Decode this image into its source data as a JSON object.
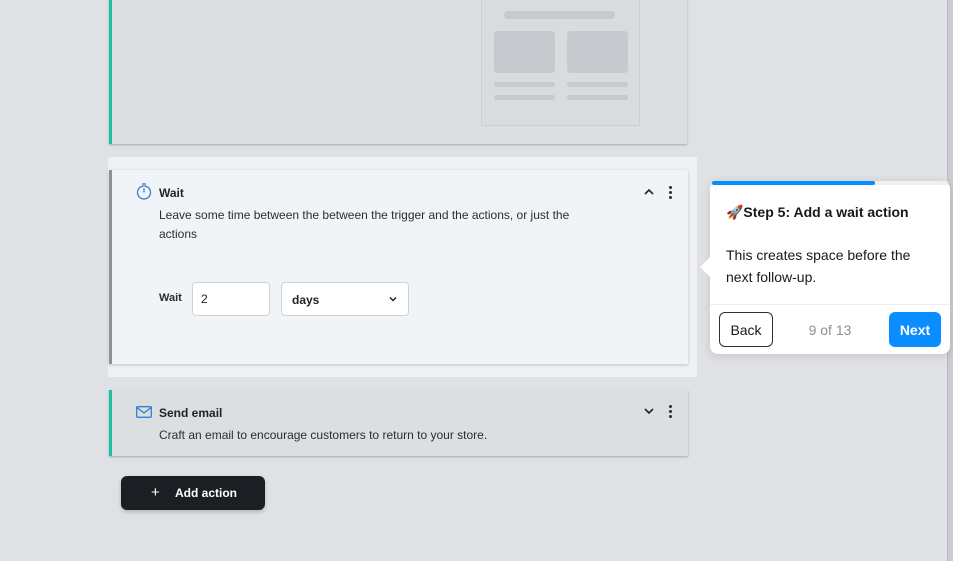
{
  "workflow": {
    "wait_card": {
      "title": "Wait",
      "description": "Leave some time between the between the trigger and the actions, or just the actions",
      "field_label": "Wait",
      "amount_value": "2",
      "unit_selected": "days",
      "icon": "clock-icon",
      "accent_color": "#8a9099"
    },
    "email_card": {
      "title": "Send email",
      "description": "Craft an email to encourage customers to return to your store.",
      "icon": "mail-icon",
      "accent_color": "#1cbfa2"
    },
    "add_action": {
      "icon": "+",
      "label": "Add action"
    }
  },
  "tour": {
    "title": "🚀Step 5: Add a wait action",
    "body": "This creates space before the next follow-up.",
    "back_label": "Back",
    "next_label": "Next",
    "step_text": "9 of 13",
    "progress": 0.69,
    "accent_color": "#0a8dff"
  }
}
